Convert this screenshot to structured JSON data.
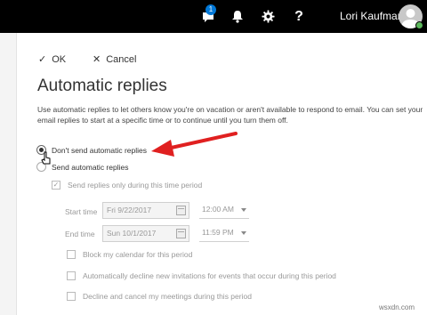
{
  "topbar": {
    "chat_badge": "1",
    "help_label": "?",
    "user_name": "Lori Kaufman",
    "icons": [
      "chat-icon",
      "bell-icon",
      "gear-icon",
      "help-icon",
      "avatar",
      "presence-dot"
    ]
  },
  "commands": {
    "ok_glyph": "✓",
    "ok_label": "OK",
    "cancel_glyph": "✕",
    "cancel_label": "Cancel"
  },
  "page": {
    "title": "Automatic replies",
    "description_line1": "Use automatic replies to let others know you're on vacation or aren't available to respond to email. You can set your",
    "description_line2": "email replies to start at a specific time or to continue until you turn them off."
  },
  "options": {
    "dont_send_label": "Don't send automatic replies",
    "dont_send_selected": true,
    "send_label": "Send automatic replies",
    "time_period_label": "Send replies only during this time period",
    "time_period_checked": true
  },
  "schedule": {
    "start_label": "Start time",
    "start_date": "Fri 9/22/2017",
    "start_time": "12:00 AM",
    "end_label": "End time",
    "end_date": "Sun 10/1/2017",
    "end_time": "11:59 PM"
  },
  "extra_options": {
    "block_calendar": "Block my calendar for this period",
    "decline_invitations": "Automatically decline new invitations for events that occur during this period",
    "decline_meetings": "Decline and cancel my meetings during this period"
  },
  "colors": {
    "topbar_bg": "#000000",
    "badge": "#0078d7",
    "arrow": "#e02020",
    "presence": "#5cb85c"
  },
  "watermark": "wsxdn.com"
}
